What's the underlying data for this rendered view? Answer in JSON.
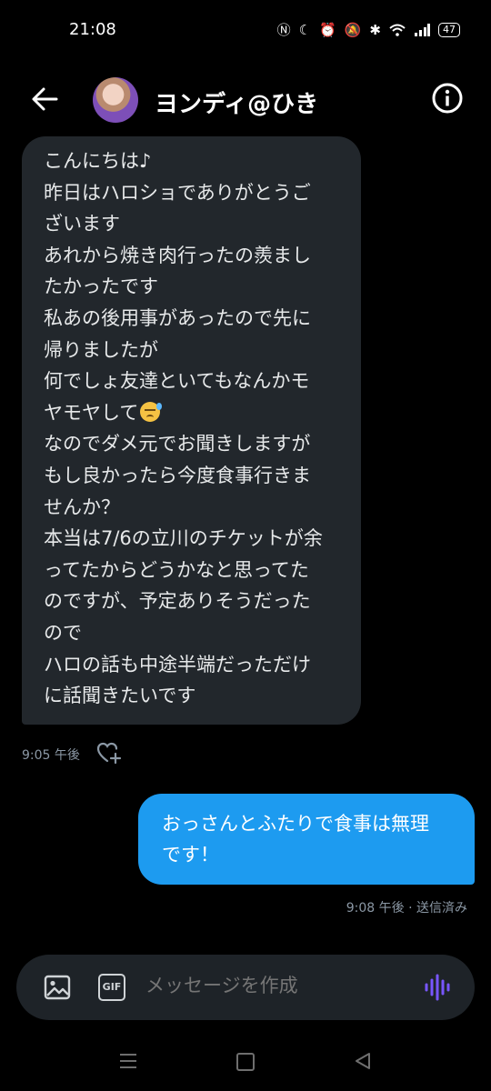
{
  "status": {
    "time": "21:08",
    "battery": "47"
  },
  "header": {
    "name": "ヨンディ@ひき"
  },
  "incoming": {
    "lines": [
      "こんにちは♪",
      "昨日はハロショでありがとうご",
      "ざいます",
      "あれから焼き肉行ったの羨まし",
      "たかったです",
      "私あの後用事があったので先に",
      "帰りましたが",
      "何でしょ友達といてもなんかモ",
      "ヤモヤして",
      "なのでダメ元でお聞きしますが",
      "もし良かったら今度食事行きま",
      "せんか？",
      "本当は7/6の立川のチケットが余",
      "ってたからどうかなと思ってた",
      "のですが、予定ありそうだった",
      "ので",
      "ハロの話も中途半端だっただけ",
      "に話聞きたいです"
    ],
    "time": "9:05 午後"
  },
  "outgoing": {
    "lines": [
      "おっさんとふたりで食事は無理",
      "です！"
    ],
    "meta": "9:08 午後 · 送信済み"
  },
  "composer": {
    "placeholder": "メッセージを作成",
    "gif_label": "GIF"
  },
  "icons": [
    "back-arrow-icon",
    "info-icon",
    "heart-plus-icon",
    "image-icon",
    "gif-icon",
    "voice-wave-icon",
    "nav-menu-icon",
    "nav-home-icon",
    "nav-back-icon"
  ],
  "colors": {
    "accent": "#1d9bf0",
    "incoming_bubble": "#22272c",
    "voice": "#7856ff"
  }
}
